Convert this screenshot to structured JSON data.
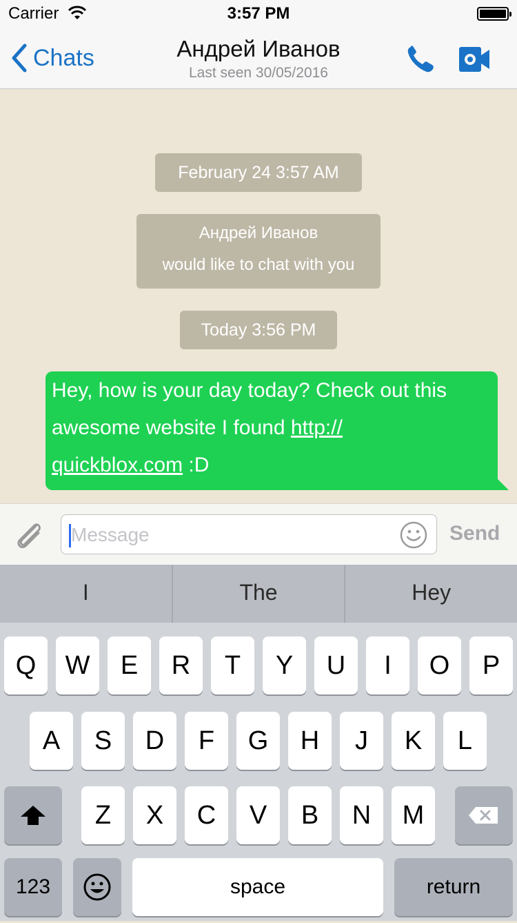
{
  "status_bar": {
    "carrier": "Carrier",
    "time": "3:57 PM"
  },
  "nav": {
    "back_label": "Chats",
    "title": "Андрей Иванов",
    "subtitle": "Last seen 30/05/2016"
  },
  "chat": {
    "system_1": "February 24 3:57 AM",
    "system_2_line1": "Андрей Иванов",
    "system_2_line2": "would like to chat with you",
    "system_3": "Today 3:56 PM",
    "message_line1": "Hey, how is your day today? Check out this",
    "message_line2_pre": "awesome website I found ",
    "message_link_part1": "http://",
    "message_link_part2": "quickblox.com",
    "message_line3_post": " :D"
  },
  "input": {
    "placeholder": "Message",
    "send_label": "Send"
  },
  "suggestions": [
    "I",
    "The",
    "Hey"
  ],
  "keyboard": {
    "row1": [
      "Q",
      "W",
      "E",
      "R",
      "T",
      "Y",
      "U",
      "I",
      "O",
      "P"
    ],
    "row2": [
      "A",
      "S",
      "D",
      "F",
      "G",
      "H",
      "J",
      "K",
      "L"
    ],
    "row3": [
      "Z",
      "X",
      "C",
      "V",
      "B",
      "N",
      "M"
    ],
    "numbers_label": "123",
    "space_label": "space",
    "return_label": "return"
  },
  "icons": [
    "wifi-icon",
    "battery-icon",
    "chevron-left-icon",
    "phone-icon",
    "video-camera-icon",
    "paperclip-icon",
    "smiley-icon",
    "shift-icon",
    "backspace-icon",
    "emoji-icon"
  ],
  "colors": {
    "accent": "#1a73c6",
    "outgoing_bubble": "#1ed153",
    "chat_bg": "#ede6d6",
    "system_bubble": "#bdb7a5"
  }
}
